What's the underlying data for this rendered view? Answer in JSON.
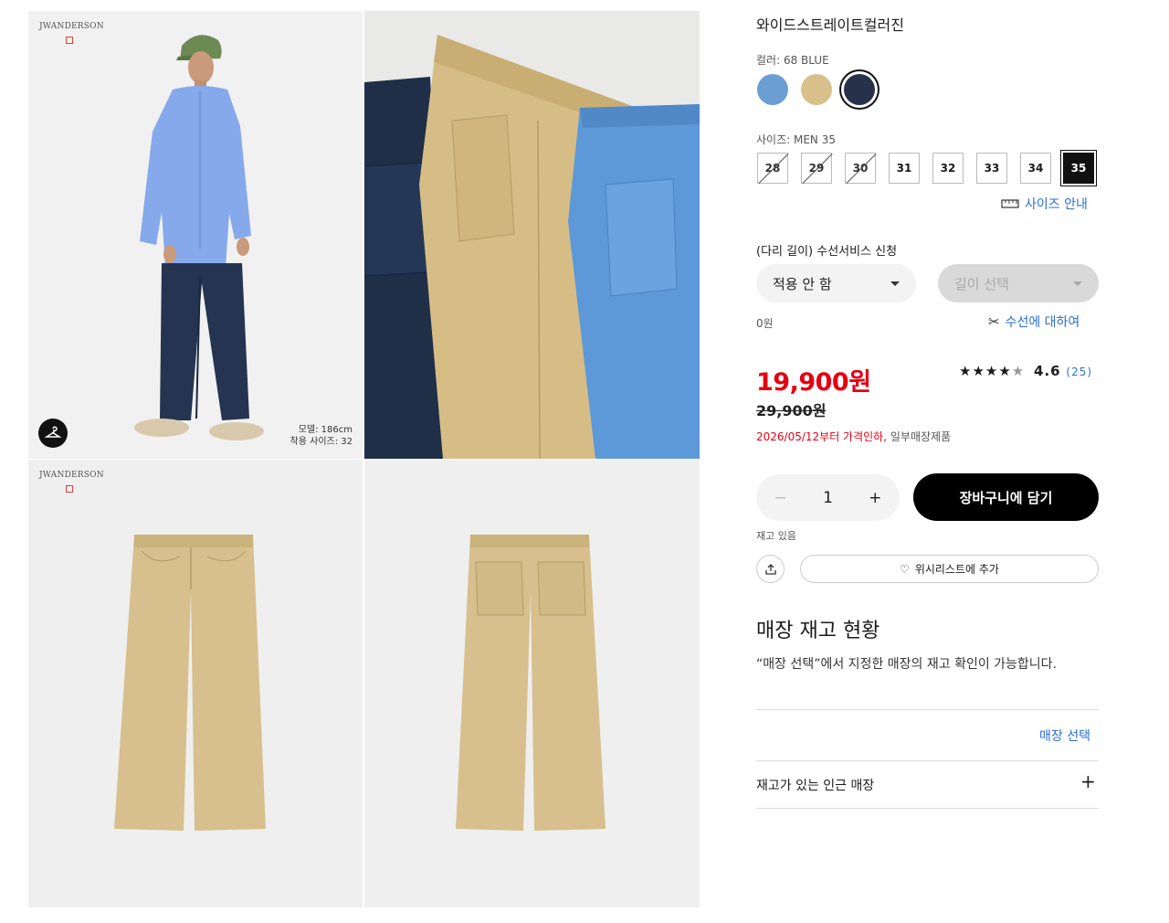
{
  "gallery": {
    "brand_text": "JWANDERSON",
    "model_height": "모델: 186cm",
    "model_size": "착용 사이즈: 32"
  },
  "product": {
    "title": "와이드스트레이트컬러진",
    "color_label": "컬러: 68 BLUE",
    "colors": [
      {
        "name": "light-blue",
        "hex": "#6b9fd4"
      },
      {
        "name": "beige",
        "hex": "#d8c08a"
      },
      {
        "name": "navy",
        "hex": "#27324a"
      }
    ],
    "size_label": "사이즈: MEN 35",
    "sizes": [
      "28",
      "29",
      "30",
      "31",
      "32",
      "33",
      "34",
      "35"
    ],
    "size_guide": "사이즈 안내",
    "alteration_label": "(다리 길이) 수선서비스 신청",
    "alteration_select": "적용 안 함",
    "length_select": "길이 선택",
    "alteration_price": "0원",
    "alteration_info": "수선에 대하여",
    "price": "19,900원",
    "old_price": "29,900원",
    "rating": "4.6",
    "review_count": "(25)",
    "price_note_red": "2026/05/12부터 가격인하,",
    "price_note_gray": "일부매장제품",
    "quantity": "1",
    "add_to_cart": "장바구니에 담기",
    "stock_status": "재고 있음",
    "wishlist": "위시리스트에 추가"
  },
  "store": {
    "heading": "매장 재고 현황",
    "description": "“매장 선택”에서 지정한 매장의 재고 확인이 가능합니다.",
    "select_store": "매장 선택",
    "nearby": "재고가 있는 인근 매장"
  },
  "colors": {
    "accent_red": "#e60012",
    "link_blue": "#2b6fd4"
  }
}
